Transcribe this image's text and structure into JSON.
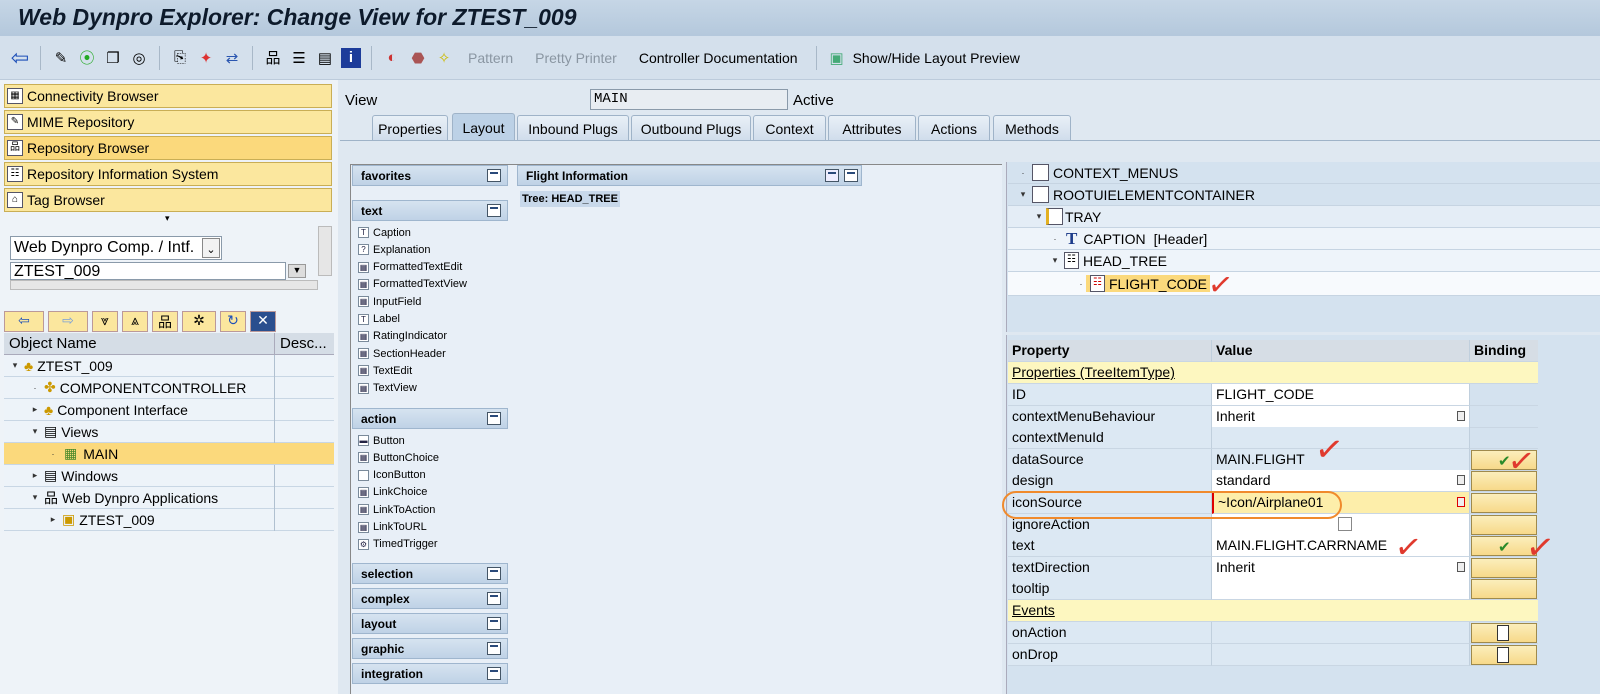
{
  "window": {
    "title": "Web Dynpro Explorer: Change View for ZTEST_009"
  },
  "toolbar": {
    "pattern": "Pattern",
    "pretty_printer": "Pretty Printer",
    "controller_doc": "Controller Documentation",
    "show_hide": "Show/Hide Layout Preview"
  },
  "left": {
    "buttons": [
      "Connectivity Browser",
      "MIME Repository",
      "Repository Browser",
      "Repository Information System",
      "Tag Browser"
    ],
    "object_type": "Web Dynpro Comp. / Intf.",
    "object_name": "ZTEST_009",
    "col_object": "Object Name",
    "col_desc": "Desc...",
    "tree": [
      "ZTEST_009",
      "COMPONENTCONTROLLER",
      "Component Interface",
      "Views",
      "MAIN",
      "Windows",
      "Web Dynpro Applications",
      "ZTEST_009"
    ]
  },
  "view": {
    "label": "View",
    "name": "MAIN",
    "status": "Active"
  },
  "tabs": [
    "Properties",
    "Layout",
    "Inbound Plugs",
    "Outbound Plugs",
    "Context",
    "Attributes",
    "Actions",
    "Methods"
  ],
  "palette": {
    "groups": {
      "favorites": "favorites",
      "text": "text",
      "action": "action",
      "selection": "selection",
      "complex": "complex",
      "layout": "layout",
      "graphic": "graphic",
      "integration": "integration"
    },
    "text_items": [
      "Caption",
      "Explanation",
      "FormattedTextEdit",
      "FormattedTextView",
      "InputField",
      "Label",
      "RatingIndicator",
      "SectionHeader",
      "TextEdit",
      "TextView"
    ],
    "action_items": [
      "Button",
      "ButtonChoice",
      "IconButton",
      "LinkChoice",
      "LinkToAction",
      "LinkToURL",
      "TimedTrigger"
    ]
  },
  "preview": {
    "title": "Flight Information",
    "tree_label": "Tree: HEAD_TREE"
  },
  "outline": [
    "CONTEXT_MENUS",
    "ROOTUIELEMENTCONTAINER",
    "TRAY",
    "CAPTION",
    "[Header]",
    "HEAD_TREE",
    "FLIGHT_CODE"
  ],
  "props": {
    "headers": [
      "Property",
      "Value",
      "Binding"
    ],
    "section1": "Properties (TreeItemType)",
    "rows": [
      {
        "p": "ID",
        "v": "FLIGHT_CODE"
      },
      {
        "p": "contextMenuBehaviour",
        "v": "Inherit"
      },
      {
        "p": "contextMenuId",
        "v": ""
      },
      {
        "p": "dataSource",
        "v": "MAIN.FLIGHT"
      },
      {
        "p": "design",
        "v": "standard"
      },
      {
        "p": "iconSource",
        "v": "~Icon/Airplane01"
      },
      {
        "p": "ignoreAction",
        "v": ""
      },
      {
        "p": "text",
        "v": "MAIN.FLIGHT.CARRNAME"
      },
      {
        "p": "textDirection",
        "v": "Inherit"
      },
      {
        "p": "tooltip",
        "v": ""
      }
    ],
    "section2": "Events",
    "events": [
      "onAction",
      "onDrop"
    ]
  }
}
